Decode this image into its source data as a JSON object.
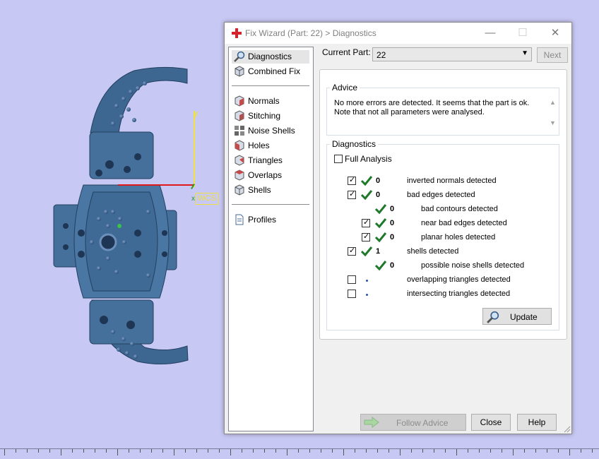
{
  "dialog": {
    "title": "Fix Wizard (Part: 22) > Diagnostics",
    "minimize": "—",
    "maximize": "☐",
    "close": "✕"
  },
  "nav": {
    "items": [
      {
        "label": "Diagnostics",
        "icon": "magnifier-icon",
        "selected": true
      },
      {
        "label": "Combined Fix",
        "icon": "cube-icon"
      },
      {
        "label": "Normals",
        "icon": "cube-normals-icon"
      },
      {
        "label": "Stitching",
        "icon": "cube-stitching-icon"
      },
      {
        "label": "Noise Shells",
        "icon": "noise-shells-icon"
      },
      {
        "label": "Holes",
        "icon": "cube-holes-icon"
      },
      {
        "label": "Triangles",
        "icon": "cube-triangles-icon"
      },
      {
        "label": "Overlaps",
        "icon": "cube-overlaps-icon"
      },
      {
        "label": "Shells",
        "icon": "cube-shells-icon"
      },
      {
        "label": "Profiles",
        "icon": "document-icon"
      }
    ]
  },
  "current_part": {
    "label": "Current Part:",
    "value": "22"
  },
  "next_label": "Next",
  "advice": {
    "title": "Advice",
    "line1": "No more errors are detected. It seems that the part is ok.",
    "line2": "Note that not all parameters were analysed."
  },
  "diagnostics": {
    "title": "Diagnostics",
    "full_analysis": "Full Analysis",
    "rows": [
      {
        "label": "inverted normals detected",
        "count": "0"
      },
      {
        "label": "bad edges detected",
        "count": "0"
      },
      {
        "label": "bad contours detected",
        "count": "0"
      },
      {
        "label": "near bad edges detected",
        "count": "0"
      },
      {
        "label": "planar holes detected",
        "count": "0"
      },
      {
        "label": "shells detected",
        "count": "1"
      },
      {
        "label": "possible noise shells detected",
        "count": "0"
      },
      {
        "label": "overlapping triangles detected",
        "count": ""
      },
      {
        "label": "intersecting triangles detected",
        "count": ""
      }
    ]
  },
  "update_label": "Update",
  "follow_advice_label": "Follow Advice",
  "close_label": "Close",
  "help_label": "Help",
  "viewport": {
    "axis_label": "WCS",
    "axis_x": "x",
    "axis_y": "y",
    "model_color": "#3d6691",
    "background": "#c8c8f4"
  },
  "colors": {
    "accent_check": "#1e7a2a",
    "title_icon": "#d4212a"
  }
}
